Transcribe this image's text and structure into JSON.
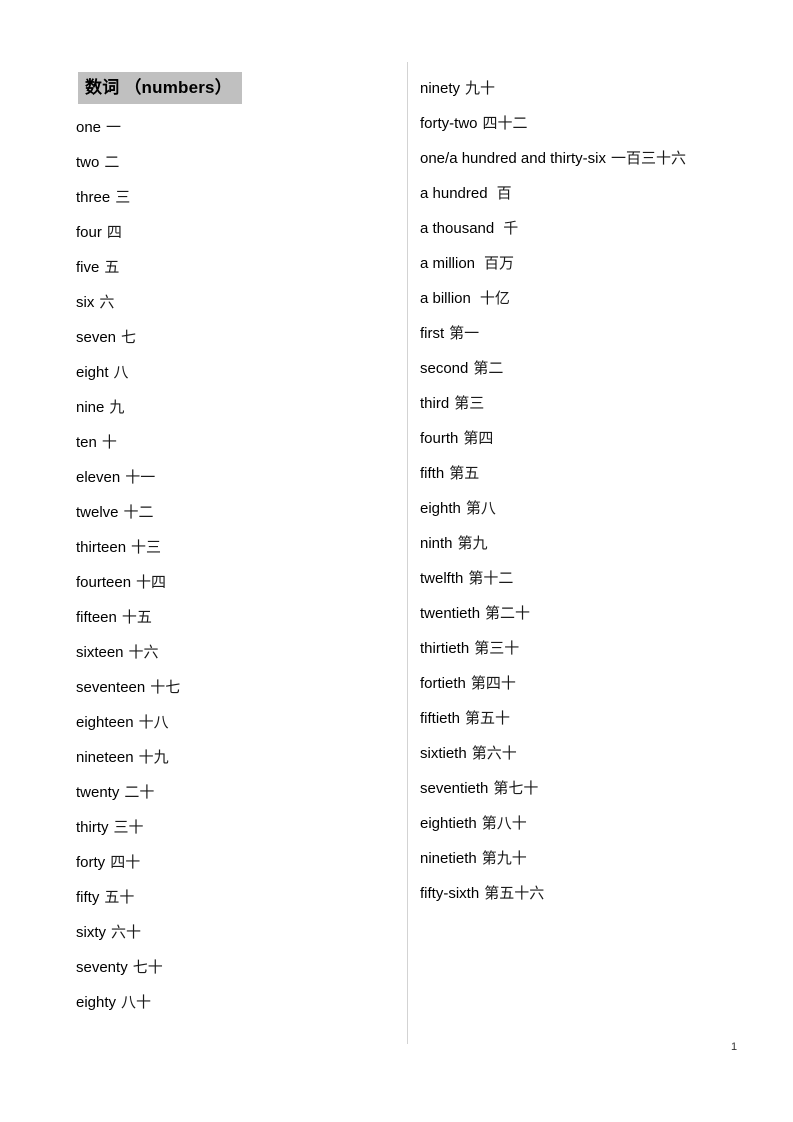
{
  "document": {
    "heading": "数词 （numbers）",
    "page_number": "1",
    "divider_color": "#d3d3d3",
    "heading_highlight_color": "#c0c0c0"
  },
  "left_column": [
    {
      "en": "one",
      "zh": "一"
    },
    {
      "en": "two",
      "zh": "二"
    },
    {
      "en": "three",
      "zh": "三"
    },
    {
      "en": "four",
      "zh": "四"
    },
    {
      "en": "five",
      "zh": "五"
    },
    {
      "en": "six",
      "zh": "六"
    },
    {
      "en": "seven",
      "zh": "七"
    },
    {
      "en": "eight",
      "zh": "八"
    },
    {
      "en": "nine",
      "zh": "九"
    },
    {
      "en": "ten",
      "zh": "十"
    },
    {
      "en": "eleven",
      "zh": "十一"
    },
    {
      "en": "twelve",
      "zh": "十二"
    },
    {
      "en": "thirteen",
      "zh": "十三"
    },
    {
      "en": "fourteen",
      "zh": "十四"
    },
    {
      "en": "fifteen",
      "zh": "十五"
    },
    {
      "en": "sixteen",
      "zh": "十六"
    },
    {
      "en": "seventeen",
      "zh": "十七"
    },
    {
      "en": "eighteen",
      "zh": "十八"
    },
    {
      "en": "nineteen",
      "zh": "十九"
    },
    {
      "en": "twenty",
      "zh": "二十"
    },
    {
      "en": "thirty",
      "zh": "三十"
    },
    {
      "en": "forty",
      "zh": "四十"
    },
    {
      "en": "fifty",
      "zh": "五十"
    },
    {
      "en": "sixty",
      "zh": "六十"
    },
    {
      "en": "seventy",
      "zh": "七十"
    },
    {
      "en": "eighty",
      "zh": "八十"
    }
  ],
  "right_column": [
    {
      "en": "ninety",
      "zh": "九十"
    },
    {
      "en": "forty-two",
      "zh": "四十二"
    },
    {
      "en": "one/a hundred and thirty-six",
      "zh": "一百三十六"
    },
    {
      "en": "a hundred",
      "zh": "百",
      "wide_gap": true
    },
    {
      "en": "a thousand",
      "zh": "千",
      "wide_gap": true
    },
    {
      "en": "a million",
      "zh": "百万",
      "wide_gap": true
    },
    {
      "en": "a billion",
      "zh": "十亿",
      "wide_gap": true
    },
    {
      "en": "first",
      "zh": "第一"
    },
    {
      "en": "second",
      "zh": "第二"
    },
    {
      "en": "third",
      "zh": "第三"
    },
    {
      "en": "fourth",
      "zh": "第四"
    },
    {
      "en": "fifth",
      "zh": "第五"
    },
    {
      "en": "eighth",
      "zh": "第八"
    },
    {
      "en": "ninth",
      "zh": "第九"
    },
    {
      "en": "twelfth",
      "zh": "第十二"
    },
    {
      "en": "twentieth",
      "zh": "第二十"
    },
    {
      "en": "thirtieth",
      "zh": "第三十"
    },
    {
      "en": "fortieth",
      "zh": "第四十"
    },
    {
      "en": "fiftieth",
      "zh": "第五十"
    },
    {
      "en": "sixtieth",
      "zh": "第六十"
    },
    {
      "en": "seventieth",
      "zh": "第七十"
    },
    {
      "en": "eightieth",
      "zh": "第八十"
    },
    {
      "en": "ninetieth",
      "zh": "第九十"
    },
    {
      "en": "fifty-sixth",
      "zh": "第五十六"
    }
  ]
}
